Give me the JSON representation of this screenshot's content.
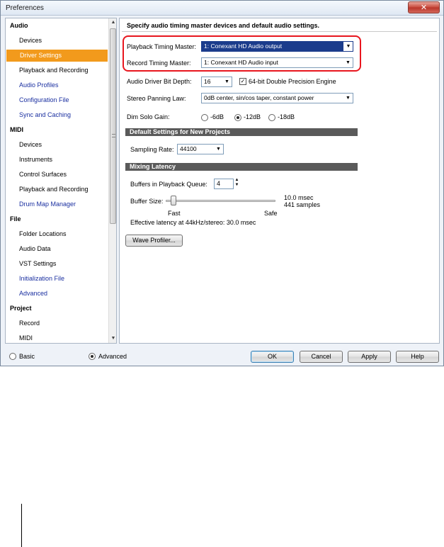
{
  "window": {
    "title": "Preferences",
    "close_glyph": "✕"
  },
  "tree": {
    "items": [
      {
        "label": "Audio",
        "kind": "cat"
      },
      {
        "label": "Devices",
        "kind": "sub"
      },
      {
        "label": "Driver Settings",
        "kind": "sub",
        "selected": true
      },
      {
        "label": "Playback and Recording",
        "kind": "sub"
      },
      {
        "label": "Audio Profiles",
        "kind": "sub",
        "link": true
      },
      {
        "label": "Configuration File",
        "kind": "sub",
        "link": true
      },
      {
        "label": "Sync and Caching",
        "kind": "sub",
        "link": true
      },
      {
        "label": "MIDI",
        "kind": "cat"
      },
      {
        "label": "Devices",
        "kind": "sub"
      },
      {
        "label": "Instruments",
        "kind": "sub"
      },
      {
        "label": "Control Surfaces",
        "kind": "sub"
      },
      {
        "label": "Playback and Recording",
        "kind": "sub"
      },
      {
        "label": "Drum Map Manager",
        "kind": "sub",
        "link": true
      },
      {
        "label": "File",
        "kind": "cat"
      },
      {
        "label": "Folder Locations",
        "kind": "sub"
      },
      {
        "label": "Audio Data",
        "kind": "sub"
      },
      {
        "label": "VST Settings",
        "kind": "sub"
      },
      {
        "label": "Initialization File",
        "kind": "sub",
        "link": true
      },
      {
        "label": "Advanced",
        "kind": "sub",
        "link": true
      },
      {
        "label": "Project",
        "kind": "cat"
      },
      {
        "label": "Record",
        "kind": "sub"
      },
      {
        "label": "MIDI",
        "kind": "sub"
      }
    ]
  },
  "panel": {
    "header": "Specify audio timing master devices and default audio settings.",
    "playback_master": {
      "label": "Playback Timing Master:",
      "value": "1: Conexant HD Audio output"
    },
    "record_master": {
      "label": "Record Timing Master:",
      "value": "1: Conexant HD Audio input"
    },
    "bit_depth": {
      "label": "Audio Driver Bit Depth:",
      "value": "16"
    },
    "double_precision": {
      "label": "64-bit Double Precision Engine",
      "checked": true
    },
    "panning_law": {
      "label": "Stereo Panning Law:",
      "value": "0dB center, sin/cos taper, constant power"
    },
    "dim_solo": {
      "label": "Dim Solo Gain:",
      "options": [
        "-6dB",
        "-12dB",
        "-18dB"
      ],
      "selected": "-12dB"
    },
    "defaults_section": "Default Settings for New Projects",
    "sampling_rate": {
      "label": "Sampling Rate:",
      "value": "44100"
    },
    "latency_section": "Mixing Latency",
    "buffers": {
      "label": "Buffers in Playback Queue:",
      "value": "4"
    },
    "buffer_size": {
      "label": "Buffer Size:",
      "msec": "10.0 msec",
      "samples": "441 samples",
      "fast": "Fast",
      "safe": "Safe",
      "position": 0.05
    },
    "effective_latency": "Effective latency at 44kHz/stereo:  30.0 msec",
    "wave_profiler": "Wave Profiler..."
  },
  "footer": {
    "mode_options": [
      "Basic",
      "Advanced"
    ],
    "mode_selected": "Advanced",
    "ok": "OK",
    "cancel": "Cancel",
    "apply": "Apply",
    "help": "Help"
  },
  "colors": {
    "selection": "#f29a1c",
    "highlight": "#e8161e",
    "section_bar": "#5a5a5a"
  }
}
